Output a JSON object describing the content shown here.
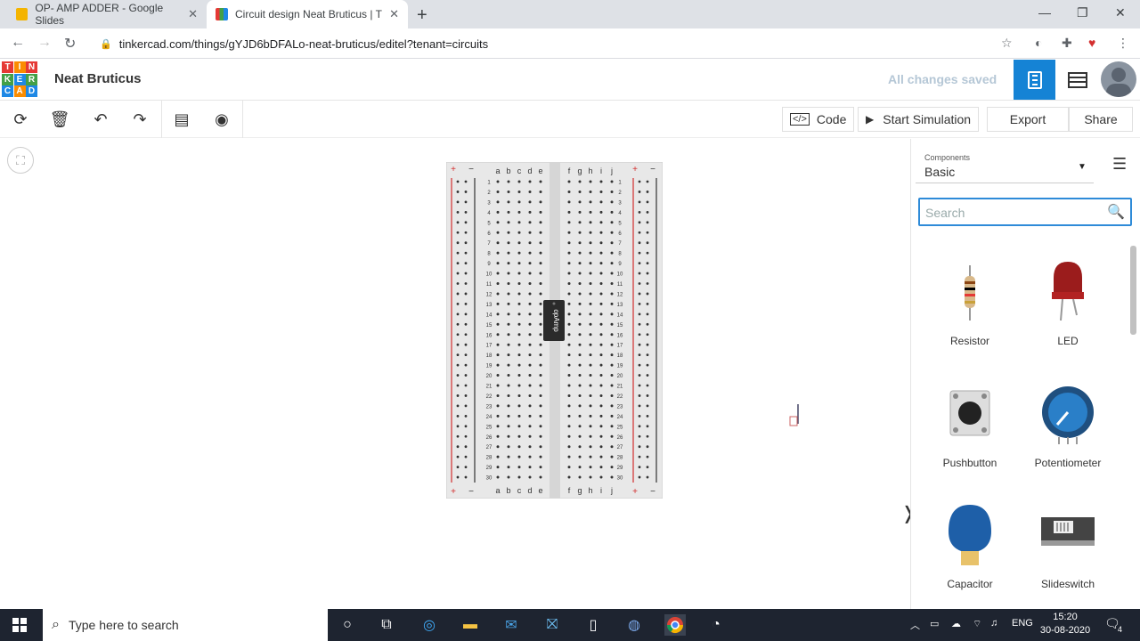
{
  "browser": {
    "tabs": [
      {
        "title": "OP- AMP ADDER - Google Slides",
        "favicon_color": "#f4b400"
      },
      {
        "title": "Circuit design Neat Bruticus | Tin",
        "favicon_color": "#e53935"
      }
    ],
    "url": "tinkercad.com/things/gYJD6bDFALo-neat-bruticus/editel?tenant=circuits"
  },
  "app": {
    "logo_letters": [
      "T",
      "I",
      "N",
      "K",
      "E",
      "R",
      "C",
      "A",
      "D"
    ],
    "project_name": "Neat Bruticus",
    "save_status": "All changes saved",
    "accent": "#1583d5"
  },
  "toolbar": {
    "code_label": "Code",
    "sim_label": "Start Simulation",
    "export_label": "Export",
    "share_label": "Share"
  },
  "breadboard": {
    "columns_left": "a b c d e",
    "columns_right": "f g h i j",
    "rows": 30,
    "chip_label": "opAmp"
  },
  "panel": {
    "components_label": "Components",
    "components_value": "Basic",
    "search_placeholder": "Search",
    "items": [
      {
        "name": "Resistor",
        "icon": "resistor-icon"
      },
      {
        "name": "LED",
        "icon": "led-icon"
      },
      {
        "name": "Pushbutton",
        "icon": "pushbutton-icon"
      },
      {
        "name": "Potentiometer",
        "icon": "potentiometer-icon"
      },
      {
        "name": "Capacitor",
        "icon": "capacitor-icon"
      },
      {
        "name": "Slideswitch",
        "icon": "slideswitch-icon"
      }
    ]
  },
  "taskbar": {
    "search_placeholder": "Type here to search",
    "language": "ENG",
    "time": "15:20",
    "date": "30-08-2020",
    "notification_count": "4"
  }
}
